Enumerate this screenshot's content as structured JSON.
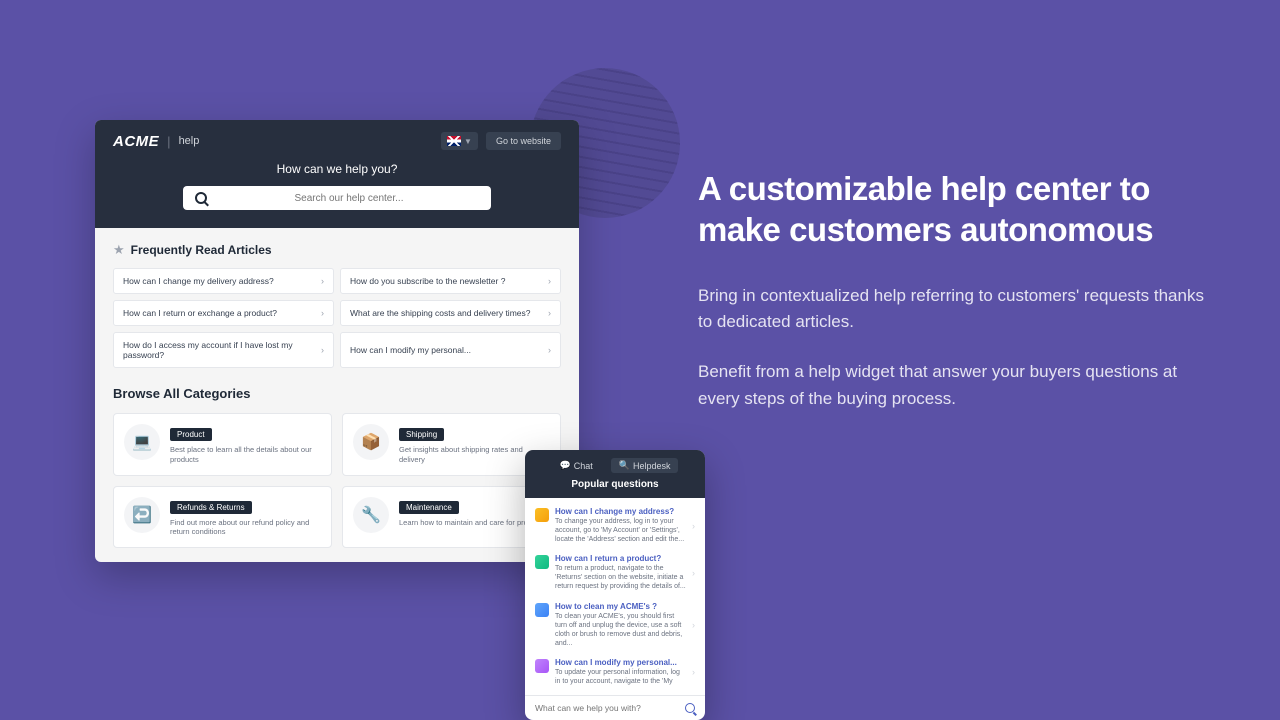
{
  "helpcenter": {
    "logo": "ACME",
    "help_label": "help",
    "go_to_website": "Go to website",
    "title": "How can we help you?",
    "search_placeholder": "Search our help center...",
    "freq_title": "Frequently Read Articles",
    "articles": [
      "How can I change my delivery address?",
      "How do you subscribe to the newsletter ?",
      "How can I return or exchange a product?",
      "What are the shipping costs and delivery times?",
      "How do I access my account if I have lost my password?",
      "How can I modify my personal..."
    ],
    "browse_title": "Browse All Categories",
    "categories": [
      {
        "tag": "Product",
        "desc": "Best place to learn all the details about our products",
        "icon": "💻"
      },
      {
        "tag": "Shipping",
        "desc": "Get insights about shipping rates and delivery",
        "icon": "📦"
      },
      {
        "tag": "Refunds & Returns",
        "desc": "Find out more about our refund policy and return conditions",
        "icon": "↩️"
      },
      {
        "tag": "Maintenance",
        "desc": "Learn how to maintain and care for products",
        "icon": "🔧"
      }
    ]
  },
  "widget": {
    "chat_tab": "Chat",
    "helpdesk_tab": "Helpdesk",
    "title": "Popular questions",
    "items": [
      {
        "q": "How can I change my address?",
        "a": "To change your address, log in to your account, go to 'My Account' or 'Settings', locate the 'Address' section and edit the..."
      },
      {
        "q": "How can I return a product?",
        "a": "To return a product, navigate to the 'Returns' section on the website, initiate a return request by providing the details of..."
      },
      {
        "q": "How to clean my ACME's ?",
        "a": "To clean your ACME's, you should first turn off and unplug the device, use a soft cloth or brush to remove dust and debris, and..."
      },
      {
        "q": "How can I modify my personal...",
        "a": "To update your personal information, log in to your account, navigate to the 'My"
      }
    ],
    "input_placeholder": "What can we help you with?"
  },
  "marketing": {
    "title": "A customizable help center to make customers autonomous",
    "p1": "Bring in contextualized help referring to customers' requests thanks to dedicated articles.",
    "p2": "Benefit from a help widget that answer your buyers questions at every steps of the buying process."
  }
}
